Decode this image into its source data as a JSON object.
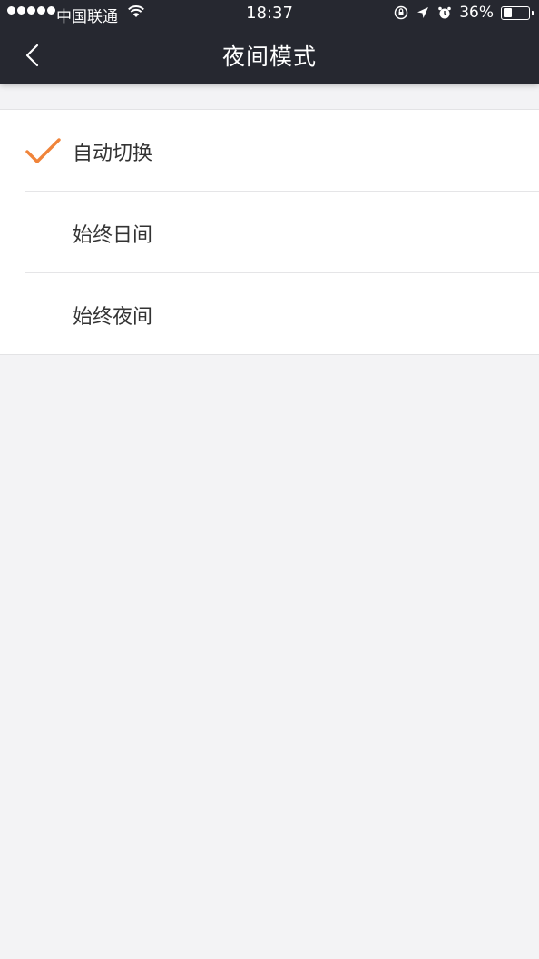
{
  "status_bar": {
    "carrier": "中国联通",
    "time": "18:37",
    "battery": "36%",
    "battery_level": 0.36
  },
  "nav": {
    "title": "夜间模式",
    "back_icon": "chevron-left-icon"
  },
  "options": [
    {
      "label": "自动切换",
      "selected": true
    },
    {
      "label": "始终日间",
      "selected": false
    },
    {
      "label": "始终夜间",
      "selected": false
    }
  ],
  "colors": {
    "header_bg": "#262830",
    "accent": "#f0843a",
    "page_bg": "#f3f3f5"
  }
}
